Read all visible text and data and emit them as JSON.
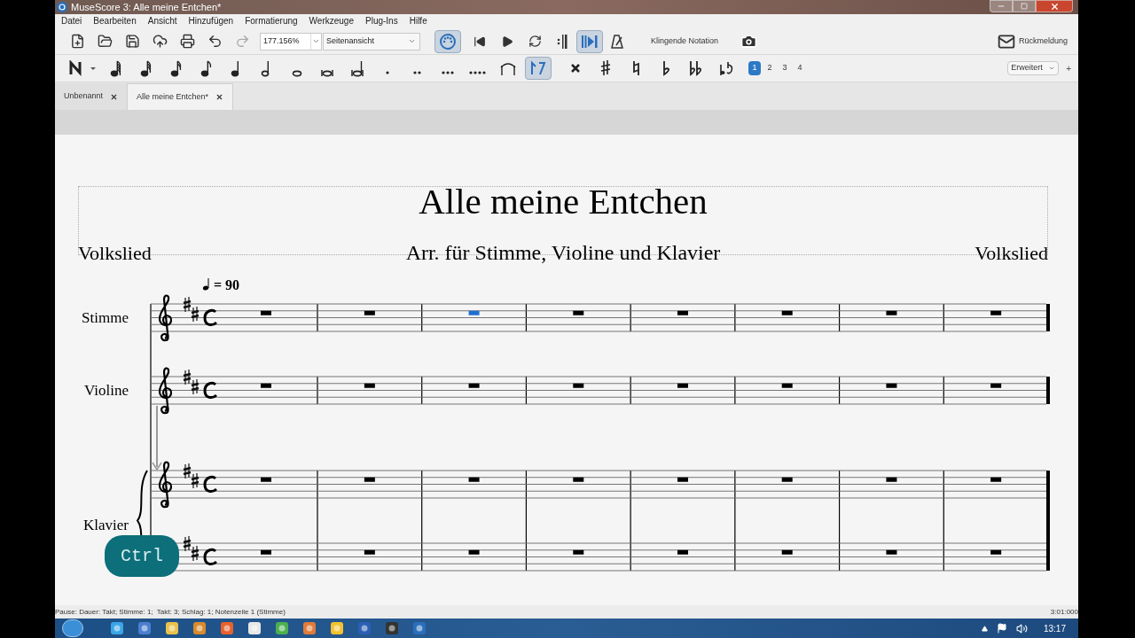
{
  "window": {
    "title": "MuseScore 3: Alle meine Entchen*"
  },
  "menu": [
    "Datei",
    "Bearbeiten",
    "Ansicht",
    "Hinzufügen",
    "Formatierung",
    "Werkzeuge",
    "Plug-Ins",
    "Hilfe"
  ],
  "toolbar": {
    "zoom": "177.156%",
    "view": "Seitenansicht",
    "redo_disabled": true,
    "midi_input_on": true,
    "pan_on": true,
    "metronome_on": false,
    "concert_pitch": "Klingende Notation",
    "feedback": "Rückmeldung"
  },
  "note_toolbar": {
    "note_input_on": false,
    "flip_on": true,
    "voices": [
      {
        "label": "1",
        "selected": true
      },
      {
        "label": "2",
        "selected": false
      },
      {
        "label": "3",
        "selected": false
      },
      {
        "label": "4",
        "selected": false
      }
    ],
    "workspace": "Erweitert",
    "add": "+"
  },
  "tabs": [
    {
      "label": "Unbenannt",
      "selected": false
    },
    {
      "label": "Alle meine Entchen*",
      "selected": true
    }
  ],
  "score": {
    "title": "Alle meine Entchen",
    "subtitle": "Arr. für Stimme, Violine und Klavier",
    "lyricist": "Volkslied",
    "composer": "Volkslied",
    "tempo": "= 90",
    "parts": [
      {
        "name": "Stimme",
        "kind": "single",
        "staves": [
          {
            "kind": "treble",
            "measures": [
              {
                "selected": false
              },
              {
                "selected": false
              },
              {
                "selected": true
              },
              {
                "selected": false
              },
              {
                "selected": false
              },
              {
                "selected": false
              },
              {
                "selected": false
              },
              {
                "selected": false
              }
            ]
          }
        ]
      },
      {
        "name": "Violine",
        "kind": "single",
        "staves": [
          {
            "kind": "treble",
            "measures": [
              {
                "selected": false
              },
              {
                "selected": false
              },
              {
                "selected": false
              },
              {
                "selected": false
              },
              {
                "selected": false
              },
              {
                "selected": false
              },
              {
                "selected": false
              },
              {
                "selected": false
              }
            ]
          }
        ]
      },
      {
        "name": "Klavier",
        "kind": "grand",
        "staves": [
          {
            "kind": "treble",
            "measures": [
              {
                "selected": false
              },
              {
                "selected": false
              },
              {
                "selected": false
              },
              {
                "selected": false
              },
              {
                "selected": false
              },
              {
                "selected": false
              },
              {
                "selected": false
              },
              {
                "selected": false
              }
            ]
          },
          {
            "measures": [
              {
                "selected": false
              },
              {
                "selected": false
              },
              {
                "selected": false
              },
              {
                "selected": false
              },
              {
                "selected": false
              },
              {
                "selected": false
              },
              {
                "selected": false
              },
              {
                "selected": false
              }
            ]
          }
        ]
      }
    ]
  },
  "key_overlay": "Ctrl",
  "status_bar": {
    "text": "Pause: Dauer: Takt; Stimme: 1;  Takt: 3; Schlag: 1; Notenzeile 1 (Stimme)",
    "time": "3:01:000"
  },
  "taskbar": {
    "clock": "13:17"
  }
}
